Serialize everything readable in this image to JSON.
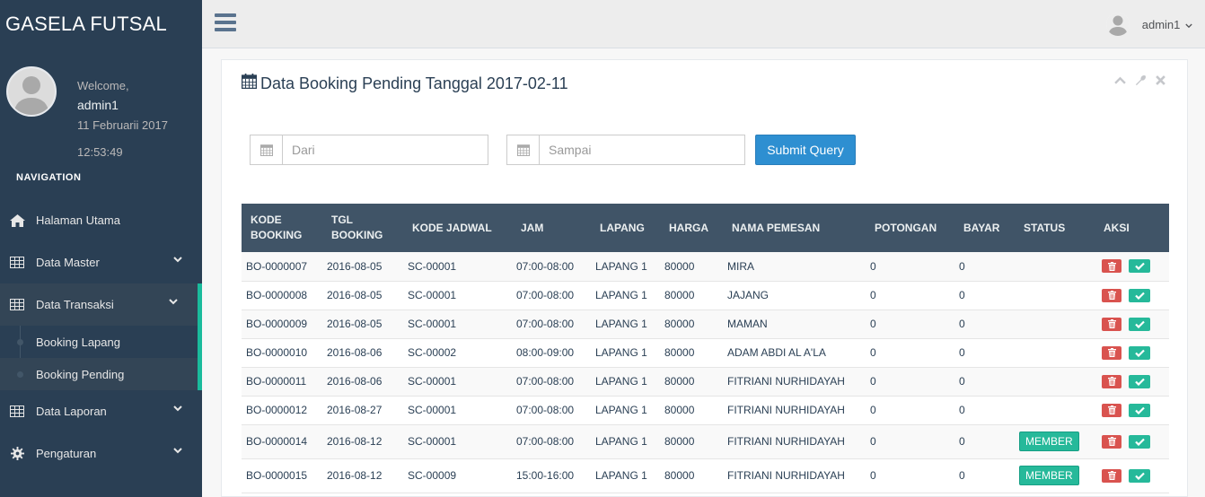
{
  "brand": "GASELA FUTSAL",
  "profile": {
    "welcome": "Welcome,",
    "username": "admin1",
    "date": "11 Februarii 2017",
    "time": "12:53:49"
  },
  "nav_title": "NAVIGATION",
  "menu": {
    "home": "Halaman Utama",
    "master": "Data Master",
    "transaksi": "Data Transaksi",
    "booking_lapang": "Booking Lapang",
    "booking_pending": "Booking Pending",
    "laporan": "Data Laporan",
    "pengaturan": "Pengaturan"
  },
  "topnav": {
    "user": "admin1"
  },
  "panel": {
    "title": "Data Booking Pending Tanggal 2017-02-11",
    "from_placeholder": "Dari",
    "to_placeholder": "Sampai",
    "submit": "Submit Query"
  },
  "table": {
    "headers": {
      "kode_booking_1": "KODE",
      "kode_booking_2": "BOOKING",
      "tgl_booking_1": "TGL",
      "tgl_booking_2": "BOOKING",
      "kode_jadwal": "KODE JADWAL",
      "jam": "JAM",
      "lapang": "LAPANG",
      "harga": "HARGA",
      "nama": "NAMA PEMESAN",
      "potongan": "POTONGAN",
      "bayar": "BAYAR",
      "status": "STATUS",
      "aksi": "AKSI"
    },
    "rows": [
      {
        "kode": "BO-0000007",
        "tgl": "2016-08-05",
        "jadwal": "SC-00001",
        "jam": "07:00-08:00",
        "lapang": "LAPANG 1",
        "harga": "80000",
        "nama": "MIRA",
        "potongan": "0",
        "bayar": "0",
        "status": ""
      },
      {
        "kode": "BO-0000008",
        "tgl": "2016-08-05",
        "jadwal": "SC-00001",
        "jam": "07:00-08:00",
        "lapang": "LAPANG 1",
        "harga": "80000",
        "nama": "JAJANG",
        "potongan": "0",
        "bayar": "0",
        "status": ""
      },
      {
        "kode": "BO-0000009",
        "tgl": "2016-08-05",
        "jadwal": "SC-00001",
        "jam": "07:00-08:00",
        "lapang": "LAPANG 1",
        "harga": "80000",
        "nama": "MAMAN",
        "potongan": "0",
        "bayar": "0",
        "status": ""
      },
      {
        "kode": "BO-0000010",
        "tgl": "2016-08-06",
        "jadwal": "SC-00002",
        "jam": "08:00-09:00",
        "lapang": "LAPANG 1",
        "harga": "80000",
        "nama": "ADAM ABDI AL A'LA",
        "potongan": "0",
        "bayar": "0",
        "status": ""
      },
      {
        "kode": "BO-0000011",
        "tgl": "2016-08-06",
        "jadwal": "SC-00001",
        "jam": "07:00-08:00",
        "lapang": "LAPANG 1",
        "harga": "80000",
        "nama": "FITRIANI NURHIDAYAH",
        "potongan": "0",
        "bayar": "0",
        "status": ""
      },
      {
        "kode": "BO-0000012",
        "tgl": "2016-08-27",
        "jadwal": "SC-00001",
        "jam": "07:00-08:00",
        "lapang": "LAPANG 1",
        "harga": "80000",
        "nama": "FITRIANI NURHIDAYAH",
        "potongan": "0",
        "bayar": "0",
        "status": ""
      },
      {
        "kode": "BO-0000014",
        "tgl": "2016-08-12",
        "jadwal": "SC-00001",
        "jam": "07:00-08:00",
        "lapang": "LAPANG 1",
        "harga": "80000",
        "nama": "FITRIANI NURHIDAYAH",
        "potongan": "0",
        "bayar": "0",
        "status": "MEMBER"
      },
      {
        "kode": "BO-0000015",
        "tgl": "2016-08-12",
        "jadwal": "SC-00009",
        "jam": "15:00-16:00",
        "lapang": "LAPANG 1",
        "harga": "80000",
        "nama": "FITRIANI NURHIDAYAH",
        "potongan": "0",
        "bayar": "0",
        "status": "MEMBER"
      }
    ]
  },
  "colors": {
    "sidebar_bg": "#2a3f54",
    "accent_green": "#26b99a",
    "primary_blue": "#2e8fd1",
    "danger_red": "#d9534f",
    "table_header": "#405467"
  }
}
